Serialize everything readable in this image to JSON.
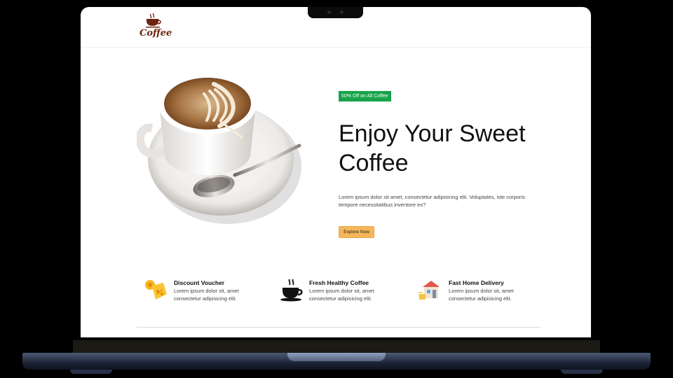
{
  "logo": {
    "text": "Coffee",
    "icon": "coffee-cup-icon",
    "color": "#6b2410"
  },
  "hero": {
    "badge": "50% Off on All Coffee",
    "badge_color": "#18a34a",
    "title": "Enjoy Your Sweet Coffee",
    "description": "Lorem ipsum dolor sit amet, consectetur adipisicing elit. Voluptates, iste corporis tempore necessitatibus inventore ex?",
    "button_label": "Explore Now",
    "button_color": "#f5b759",
    "image": "latte-cup-with-spoon"
  },
  "features": [
    {
      "title": "Discount Voucher",
      "description": "Lorem ipsum dolor sit, amet consectetur adipisicing elit.",
      "icon": "discount-voucher-icon"
    },
    {
      "title": "Fresh Healthy Coffee",
      "description": "Lorem ipsum dolor sit, amet consectetur adipisicing elit.",
      "icon": "coffee-cup-icon"
    },
    {
      "title": "Fast Home Delivery",
      "description": "Lorem ipsum dolor sit, amet consectetur adipisicing elit.",
      "icon": "home-delivery-icon"
    }
  ]
}
